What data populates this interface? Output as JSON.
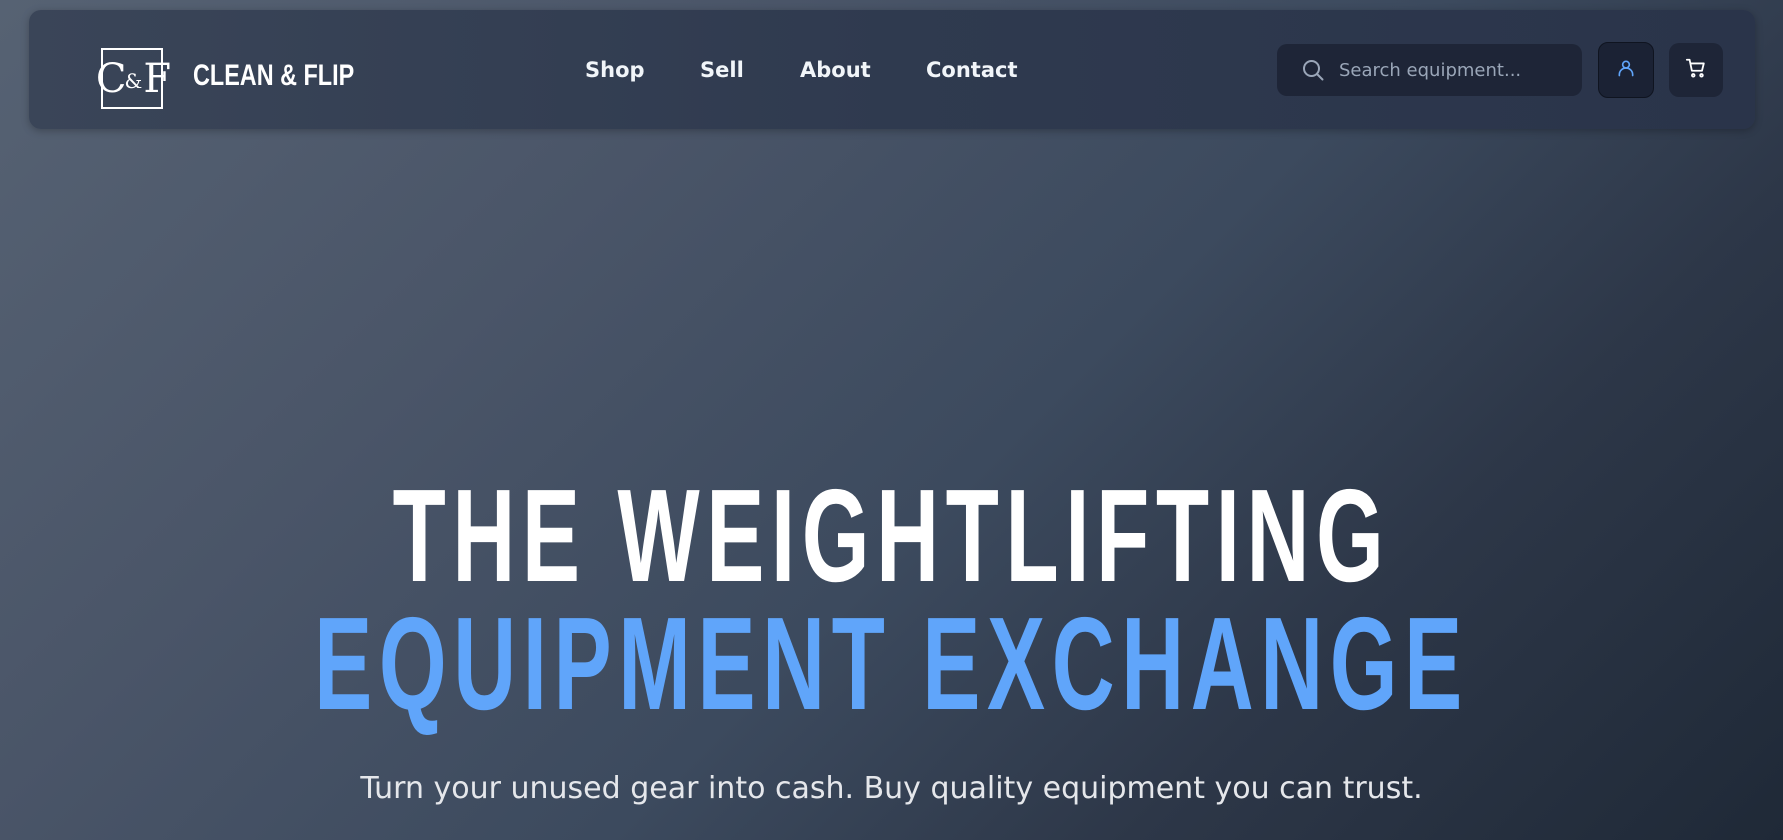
{
  "header": {
    "logo_text": "C&F",
    "brand_name": "CLEAN & FLIP",
    "nav": [
      {
        "label": "Shop"
      },
      {
        "label": "Sell"
      },
      {
        "label": "About"
      },
      {
        "label": "Contact"
      }
    ],
    "search": {
      "placeholder": "Search equipment...",
      "value": ""
    },
    "icons": {
      "search": "search-icon",
      "user": "user-icon",
      "cart": "cart-icon"
    }
  },
  "hero": {
    "line1": "THE WEIGHTLIFTING",
    "line2": "EQUIPMENT EXCHANGE",
    "subtitle": "Turn your unused gear into cash. Buy quality equipment you can trust."
  },
  "colors": {
    "accent": "#60a5fa",
    "header_bg": "#2f3a4f",
    "button_bg": "#1e2537",
    "text": "#ffffff"
  }
}
